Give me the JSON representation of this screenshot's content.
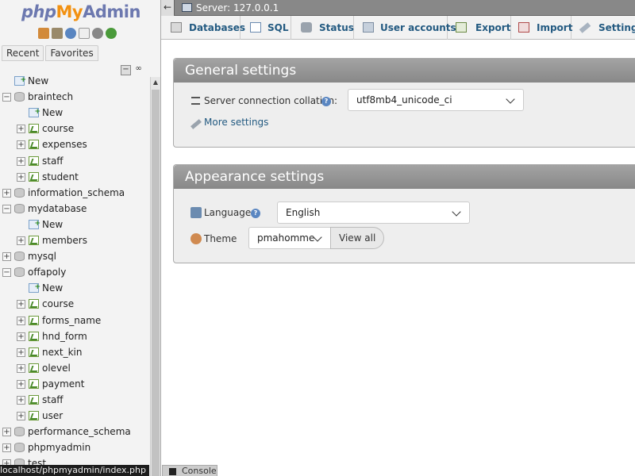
{
  "nav": {
    "logo": {
      "php": "php",
      "my": "My",
      "admin": "Admin"
    },
    "icons": [
      "home-icon",
      "database-icon",
      "help-icon",
      "docs-icon",
      "settings-icon",
      "reload-icon"
    ],
    "tabs": [
      "Recent",
      "Favorites"
    ],
    "tree": [
      {
        "label": "New",
        "level": 0,
        "kind": "new",
        "expander": ""
      },
      {
        "label": "braintech",
        "level": 0,
        "kind": "db",
        "expander": "−"
      },
      {
        "label": "New",
        "level": 1,
        "kind": "new",
        "expander": ""
      },
      {
        "label": "course",
        "level": 1,
        "kind": "tbl",
        "expander": "+"
      },
      {
        "label": "expenses",
        "level": 1,
        "kind": "tbl",
        "expander": "+"
      },
      {
        "label": "staff",
        "level": 1,
        "kind": "tbl",
        "expander": "+"
      },
      {
        "label": "student",
        "level": 1,
        "kind": "tbl",
        "expander": "+"
      },
      {
        "label": "information_schema",
        "level": 0,
        "kind": "db",
        "expander": "+"
      },
      {
        "label": "mydatabase",
        "level": 0,
        "kind": "db",
        "expander": "−"
      },
      {
        "label": "New",
        "level": 1,
        "kind": "new",
        "expander": ""
      },
      {
        "label": "members",
        "level": 1,
        "kind": "tbl",
        "expander": "+"
      },
      {
        "label": "mysql",
        "level": 0,
        "kind": "db",
        "expander": "+"
      },
      {
        "label": "offapoly",
        "level": 0,
        "kind": "db",
        "expander": "−"
      },
      {
        "label": "New",
        "level": 1,
        "kind": "new",
        "expander": ""
      },
      {
        "label": "course",
        "level": 1,
        "kind": "tbl",
        "expander": "+"
      },
      {
        "label": "forms_name",
        "level": 1,
        "kind": "tbl",
        "expander": "+"
      },
      {
        "label": "hnd_form",
        "level": 1,
        "kind": "tbl",
        "expander": "+"
      },
      {
        "label": "next_kin",
        "level": 1,
        "kind": "tbl",
        "expander": "+"
      },
      {
        "label": "olevel",
        "level": 1,
        "kind": "tbl",
        "expander": "+"
      },
      {
        "label": "payment",
        "level": 1,
        "kind": "tbl",
        "expander": "+"
      },
      {
        "label": "staff",
        "level": 1,
        "kind": "tbl",
        "expander": "+"
      },
      {
        "label": "user",
        "level": 1,
        "kind": "tbl",
        "expander": "+"
      },
      {
        "label": "performance_schema",
        "level": 0,
        "kind": "db",
        "expander": "+"
      },
      {
        "label": "phpmyadmin",
        "level": 0,
        "kind": "db",
        "expander": "+"
      },
      {
        "label": "test",
        "level": 0,
        "kind": "db",
        "expander": "+"
      }
    ],
    "status_url": "localhost/phpmyadmin/index.php"
  },
  "topbar": {
    "back": "←",
    "server": "Server: 127.0.0.1"
  },
  "menu": [
    {
      "label": "Databases",
      "icon": "databases-icon"
    },
    {
      "label": "SQL",
      "icon": "sql-icon"
    },
    {
      "label": "Status",
      "icon": "status-icon"
    },
    {
      "label": "User accounts",
      "icon": "user-accounts-icon"
    },
    {
      "label": "Export",
      "icon": "export-icon"
    },
    {
      "label": "Import",
      "icon": "import-icon"
    },
    {
      "label": "Settings",
      "icon": "settings-wrench-icon"
    }
  ],
  "general": {
    "title": "General settings",
    "collation_label": "Server connection collation:",
    "collation_value": "utf8mb4_unicode_ci",
    "more_settings": "More settings"
  },
  "appearance": {
    "title": "Appearance settings",
    "language_label": "Language",
    "language_value": "English",
    "theme_label": "Theme",
    "theme_value": "pmahomme",
    "view_all": "View all"
  },
  "console": {
    "label": "Console"
  },
  "colors": {
    "link": "#235a81",
    "panel_head": "#8f8f8f",
    "logo_orange": "#f29111",
    "logo_blue": "#6c78af"
  }
}
